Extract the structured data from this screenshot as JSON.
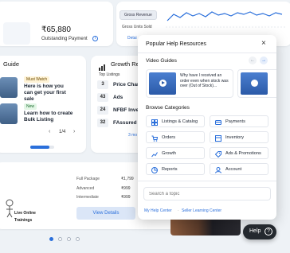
{
  "top": {
    "payment_value": "₹65,880",
    "payment_label": "Outstanding Payment",
    "pill1": "Gross Revenue",
    "pill2": "Gross Units Sold",
    "details_link": "Detai"
  },
  "guide": {
    "title": "Guide",
    "item1_badge": "Must Watch",
    "item1_text": "Here is how you can get your first sale",
    "item2_badge": "New",
    "item2_text": "Learn how to create Bulk Listing",
    "pager": "1/4"
  },
  "growth": {
    "title": "Growth Re",
    "subtitle": "Top Listings",
    "rows": [
      {
        "rank": "3",
        "label": "Price Chang"
      },
      {
        "rank": "43",
        "label": "Ads"
      },
      {
        "rank": "24",
        "label": "NFBF Inven"
      },
      {
        "rank": "32",
        "label": "FAssured"
      }
    ],
    "more": "3 mo"
  },
  "package": {
    "rows": [
      {
        "name": "Full Package",
        "price": "₹1,799"
      },
      {
        "name": "Advanced",
        "price": "₹999"
      },
      {
        "name": "Intermediate",
        "price": "₹999"
      }
    ],
    "view_details": "View Details",
    "live_line1": "Live Online",
    "live_line2": "Trainings"
  },
  "help_panel": {
    "title": "Popular Help Resources",
    "video_guides": "Video Guides",
    "video1_text": "Why have I received an order even when stock was over (Out of Stock)...",
    "browse_categories": "Browse Categories",
    "categories": [
      {
        "label": "Listings & Catalog",
        "icon": "catalog-icon"
      },
      {
        "label": "Payments",
        "icon": "payments-icon"
      },
      {
        "label": "Orders",
        "icon": "orders-icon"
      },
      {
        "label": "Inventory",
        "icon": "inventory-icon"
      },
      {
        "label": "Growth",
        "icon": "growth-icon"
      },
      {
        "label": "Ads & Promotions",
        "icon": "ads-icon"
      },
      {
        "label": "Reports",
        "icon": "reports-icon"
      },
      {
        "label": "Account",
        "icon": "account-icon"
      }
    ],
    "search_placeholder": "Search a topic",
    "link1": "My Help Center",
    "link_sep": "·",
    "link2": "Seller Learning Center"
  },
  "help_button": "Help",
  "colors": {
    "brand": "#2a6fdb",
    "accent_badge": "#fff3d6",
    "new_badge": "#e3f6e6"
  }
}
